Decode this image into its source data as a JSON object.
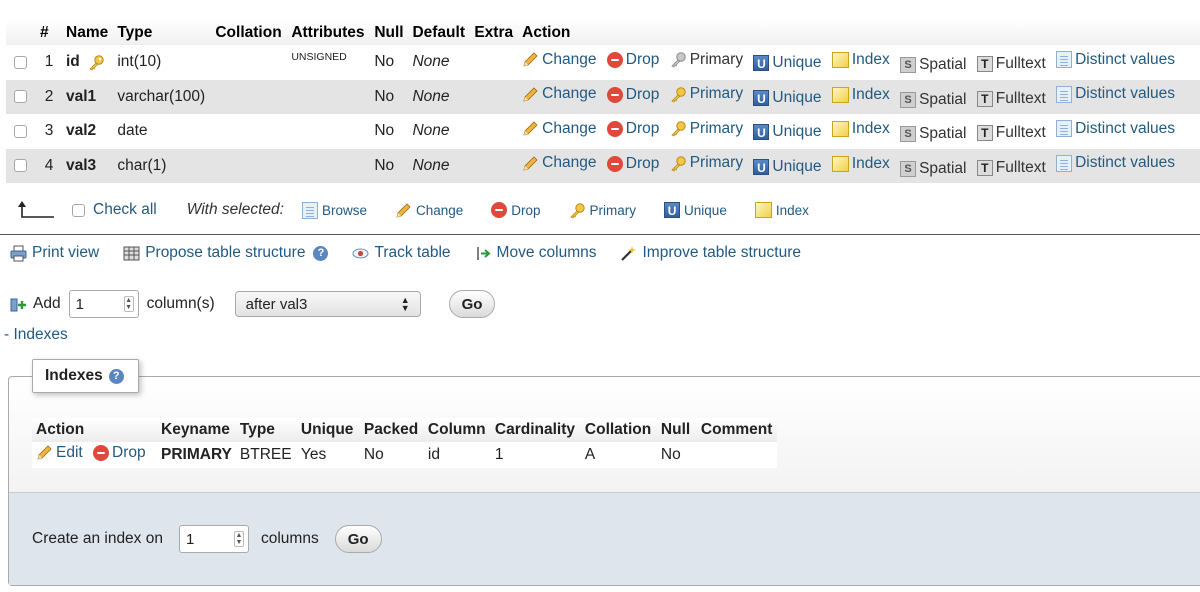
{
  "structure": {
    "headers": [
      "#",
      "Name",
      "Type",
      "Collation",
      "Attributes",
      "Null",
      "Default",
      "Extra",
      "Action"
    ],
    "rows": [
      {
        "num": "1",
        "name": "id",
        "type": "int(10)",
        "collation": "",
        "attributes": "UNSIGNED",
        "null": "No",
        "default": "None",
        "extra": ""
      },
      {
        "num": "2",
        "name": "val1",
        "type": "varchar(100)",
        "collation": "",
        "attributes": "",
        "null": "No",
        "default": "None",
        "extra": ""
      },
      {
        "num": "3",
        "name": "val2",
        "type": "date",
        "collation": "",
        "attributes": "",
        "null": "No",
        "default": "None",
        "extra": ""
      },
      {
        "num": "4",
        "name": "val3",
        "type": "char(1)",
        "collation": "",
        "attributes": "",
        "null": "No",
        "default": "None",
        "extra": ""
      }
    ],
    "actions": {
      "change": "Change",
      "drop": "Drop",
      "primary": "Primary",
      "unique": "Unique",
      "index": "Index",
      "spatial": "Spatial",
      "fulltext": "Fulltext",
      "distinct": "Distinct values"
    }
  },
  "with_selected": {
    "check_all": "Check all",
    "label": "With selected:",
    "browse": "Browse",
    "change": "Change",
    "drop": "Drop",
    "primary": "Primary",
    "unique": "Unique",
    "index": "Index"
  },
  "tools": {
    "print_view": "Print view",
    "propose": "Propose table structure",
    "track": "Track table",
    "move": "Move columns",
    "improve": "Improve table structure"
  },
  "add_column": {
    "label": "Add",
    "count": "1",
    "unit": "column(s)",
    "position": "after val3",
    "go": "Go"
  },
  "indexes_toggle": "- Indexes",
  "indexes": {
    "legend": "Indexes",
    "headers": [
      "Action",
      "Keyname",
      "Type",
      "Unique",
      "Packed",
      "Column",
      "Cardinality",
      "Collation",
      "Null",
      "Comment"
    ],
    "rows": [
      {
        "edit": "Edit",
        "drop": "Drop",
        "keyname": "PRIMARY",
        "type": "BTREE",
        "unique": "Yes",
        "packed": "No",
        "column": "id",
        "cardinality": "1",
        "collation": "A",
        "null": "No",
        "comment": ""
      }
    ],
    "create_label": "Create an index on",
    "create_count": "1",
    "create_unit": "columns",
    "create_go": "Go"
  },
  "colors": {
    "link": "#235a81",
    "row_alt": "#e4e4e4",
    "drop_icon": "#e0483b",
    "band": "#dfe5ec"
  }
}
